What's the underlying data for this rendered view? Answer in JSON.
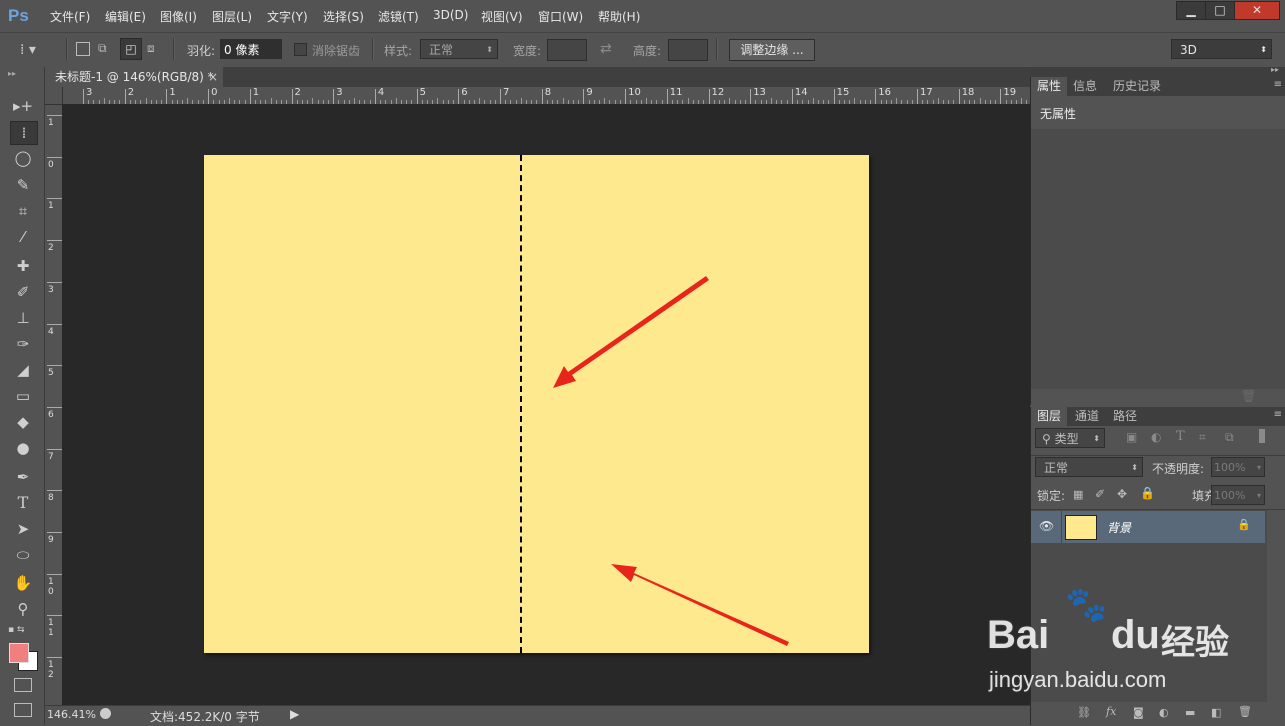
{
  "app": {
    "logo": "Ps"
  },
  "menu": [
    "文件(F)",
    "编辑(E)",
    "图像(I)",
    "图层(L)",
    "文字(Y)",
    "选择(S)",
    "滤镜(T)",
    "3D(D)",
    "视图(V)",
    "窗口(W)",
    "帮助(H)"
  ],
  "window_controls": {
    "minimize": "▁",
    "maximize": "□",
    "close": "✕"
  },
  "options": {
    "feather_label": "羽化:",
    "feather_value": "0 像素",
    "antialias_label": "消除锯齿",
    "style_label": "样式:",
    "style_value": "正常",
    "width_label": "宽度:",
    "height_label": "高度:",
    "refine_edge": "调整边缘 ...",
    "workspace": "3D"
  },
  "document": {
    "tab_title": "未标题-1 @ 146%(RGB/8) *",
    "tab_close": "×",
    "zoom": "146.41%",
    "doc_info": "文档:452.2K/0 字节",
    "canvas_color": "#ffe98e",
    "ruler_top": [
      "3",
      "2",
      "1",
      "0",
      "1",
      "2",
      "3",
      "4",
      "5",
      "6",
      "7",
      "8",
      "9",
      "10",
      "11",
      "12",
      "13",
      "14",
      "15",
      "16",
      "17",
      "18",
      "19"
    ],
    "ruler_left": [
      "1",
      "0",
      "1",
      "2",
      "3",
      "4",
      "5",
      "6",
      "7",
      "8",
      "9",
      "1\n0",
      "1\n1",
      "1\n2"
    ]
  },
  "properties_panel": {
    "tabs": [
      "属性",
      "信息",
      "历史记录"
    ],
    "content": "无属性"
  },
  "layers_panel": {
    "tabs": [
      "图层",
      "通道",
      "路径"
    ],
    "filter_kind": "类型",
    "blend_mode": "正常",
    "opacity_label": "不透明度:",
    "opacity_value": "100%",
    "lock_label": "锁定:",
    "fill_label": "填充:",
    "fill_value": "100%",
    "layers": [
      {
        "name": "背景",
        "thumb_color": "#ffe98e",
        "locked": true,
        "visible": true
      }
    ]
  },
  "watermark": {
    "brand": "Bai",
    "brand2": "du",
    "cn": "经验",
    "url": "jingyan.baidu.com"
  },
  "colors": {
    "foreground": "#f08080",
    "background": "#ffffff",
    "arrow": "#e8251a",
    "selected_layer": "#596979"
  }
}
